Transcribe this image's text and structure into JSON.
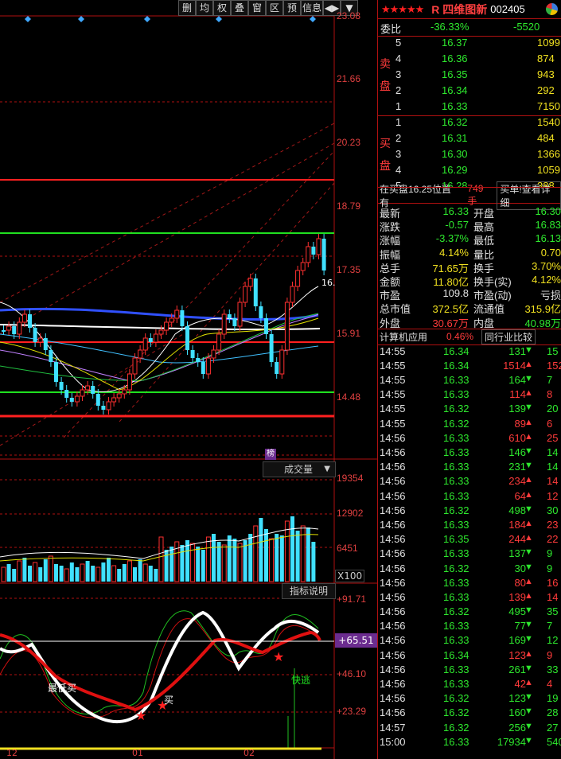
{
  "toolbar": {
    "buttons": [
      "删",
      "均",
      "权",
      "叠",
      "窗",
      "区",
      "预",
      "信息",
      "◀▶",
      "▼"
    ]
  },
  "price_axis": [
    "23.08",
    "21.66",
    "20.23",
    "18.79",
    "17.35",
    "15.91",
    "14.48"
  ],
  "vol_axis": [
    "19354",
    "12902",
    "6451"
  ],
  "ind_axis": {
    "top": "+91.71",
    "highlight": "+65.51",
    "mid": "+46.10",
    "low": "+23.29"
  },
  "chart": {
    "last_price_label": "16.",
    "vol_dropdown": "成交量",
    "ind_dropdown": "指标说明",
    "x100": "X100",
    "bang": "榜",
    "annot_low_buy": "最低买",
    "annot_buy": "买",
    "annot_escape": "快逃",
    "x_labels": [
      "12",
      "01",
      "02"
    ],
    "colors": {
      "up": "#ff3030",
      "down": "#40e0ff",
      "ma_white": "#ffffff",
      "ma_red": "#dd1111"
    }
  },
  "header": {
    "stars": "★★★★★",
    "prefix": "R",
    "name": "四维图新",
    "code": "002405"
  },
  "orderbook": {
    "weibi_label": "委比",
    "weibi_pct": "-36.33%",
    "weibi_diff": "-5520",
    "sell_label": "卖盘",
    "buy_label": "买盘",
    "sell": [
      {
        "n": "5",
        "price": "16.37",
        "vol": "1099"
      },
      {
        "n": "4",
        "price": "16.36",
        "vol": "874"
      },
      {
        "n": "3",
        "price": "16.35",
        "vol": "943"
      },
      {
        "n": "2",
        "price": "16.34",
        "vol": "292"
      },
      {
        "n": "1",
        "price": "16.33",
        "vol": "7150"
      }
    ],
    "buy": [
      {
        "n": "1",
        "price": "16.32",
        "vol": "1540"
      },
      {
        "n": "2",
        "price": "16.31",
        "vol": "484"
      },
      {
        "n": "3",
        "price": "16.30",
        "vol": "1366"
      },
      {
        "n": "4",
        "price": "16.29",
        "vol": "1059"
      },
      {
        "n": "5",
        "price": "16.28",
        "vol": "388"
      }
    ]
  },
  "notice": {
    "text": "在买盘16.25位置有",
    "qty": "749手",
    "link": "买单!查看详细"
  },
  "quote": [
    {
      "l1": "最新",
      "v1": "16.33",
      "c1": "green",
      "l2": "开盘",
      "v2": "16.30",
      "c2": "green"
    },
    {
      "l1": "涨跌",
      "v1": "-0.57",
      "c1": "green",
      "l2": "最高",
      "v2": "16.83",
      "c2": "green"
    },
    {
      "l1": "涨幅",
      "v1": "-3.37%",
      "c1": "green",
      "l2": "最低",
      "v2": "16.13",
      "c2": "green"
    },
    {
      "l1": "振幅",
      "v1": "4.14%",
      "c1": "yellow",
      "l2": "量比",
      "v2": "0.70",
      "c2": "yellow"
    },
    {
      "l1": "总手",
      "v1": "71.65万",
      "c1": "yellow",
      "l2": "换手",
      "v2": "3.70%",
      "c2": "yellow"
    },
    {
      "l1": "金额",
      "v1": "11.80亿",
      "c1": "yellow",
      "l2": "换手(实)",
      "v2": "4.12%",
      "c2": "yellow"
    },
    {
      "l1": "市盈",
      "v1": "109.8",
      "c1": "white",
      "l2": "市盈(动)",
      "v2": "亏损",
      "c2": "white"
    },
    {
      "l1": "总市值",
      "v1": "372.5亿",
      "c1": "yellow",
      "l2": "流通值",
      "v2": "315.9亿",
      "c2": "yellow"
    },
    {
      "l1": "外盘",
      "v1": "30.67万",
      "c1": "red",
      "l2": "内盘",
      "v2": "40.98万",
      "c2": "green"
    }
  ],
  "sector": {
    "name": "计算机应用",
    "pct": "0.46%",
    "compare": "同行业比较"
  },
  "ticks": [
    {
      "t": "14:55",
      "p": "16.34",
      "pc": "green",
      "v": "131",
      "d": "down",
      "x": "15"
    },
    {
      "t": "14:55",
      "p": "16.34",
      "pc": "green",
      "v": "1514",
      "d": "up",
      "x": "152"
    },
    {
      "t": "14:55",
      "p": "16.33",
      "pc": "green",
      "v": "164",
      "d": "down",
      "x": "7"
    },
    {
      "t": "14:55",
      "p": "16.33",
      "pc": "green",
      "v": "114",
      "d": "up",
      "x": "8"
    },
    {
      "t": "14:55",
      "p": "16.32",
      "pc": "green",
      "v": "139",
      "d": "down",
      "x": "20"
    },
    {
      "t": "14:55",
      "p": "16.32",
      "pc": "green",
      "v": "89",
      "d": "up",
      "x": "6"
    },
    {
      "t": "14:56",
      "p": "16.33",
      "pc": "green",
      "v": "610",
      "d": "up",
      "x": "25"
    },
    {
      "t": "14:56",
      "p": "16.33",
      "pc": "green",
      "v": "146",
      "d": "down",
      "x": "14"
    },
    {
      "t": "14:56",
      "p": "16.33",
      "pc": "green",
      "v": "231",
      "d": "down",
      "x": "14"
    },
    {
      "t": "14:56",
      "p": "16.33",
      "pc": "green",
      "v": "234",
      "d": "up",
      "x": "14"
    },
    {
      "t": "14:56",
      "p": "16.33",
      "pc": "green",
      "v": "64",
      "d": "up",
      "x": "12"
    },
    {
      "t": "14:56",
      "p": "16.32",
      "pc": "green",
      "v": "498",
      "d": "down",
      "x": "30"
    },
    {
      "t": "14:56",
      "p": "16.33",
      "pc": "green",
      "v": "184",
      "d": "up",
      "x": "23"
    },
    {
      "t": "14:56",
      "p": "16.35",
      "pc": "green",
      "v": "244",
      "d": "up",
      "x": "22"
    },
    {
      "t": "14:56",
      "p": "16.33",
      "pc": "green",
      "v": "137",
      "d": "down",
      "x": "9"
    },
    {
      "t": "14:56",
      "p": "16.32",
      "pc": "green",
      "v": "30",
      "d": "down",
      "x": "9"
    },
    {
      "t": "14:56",
      "p": "16.33",
      "pc": "green",
      "v": "80",
      "d": "up",
      "x": "16"
    },
    {
      "t": "14:56",
      "p": "16.33",
      "pc": "green",
      "v": "139",
      "d": "up",
      "x": "14"
    },
    {
      "t": "14:56",
      "p": "16.32",
      "pc": "green",
      "v": "495",
      "d": "down",
      "x": "35"
    },
    {
      "t": "14:56",
      "p": "16.33",
      "pc": "green",
      "v": "77",
      "d": "down",
      "x": "7"
    },
    {
      "t": "14:56",
      "p": "16.33",
      "pc": "green",
      "v": "169",
      "d": "down",
      "x": "12"
    },
    {
      "t": "14:56",
      "p": "16.34",
      "pc": "green",
      "v": "123",
      "d": "up",
      "x": "9"
    },
    {
      "t": "14:56",
      "p": "16.33",
      "pc": "green",
      "v": "261",
      "d": "down",
      "x": "33"
    },
    {
      "t": "14:56",
      "p": "16.33",
      "pc": "green",
      "v": "42",
      "d": "up",
      "x": "4"
    },
    {
      "t": "14:56",
      "p": "16.32",
      "pc": "green",
      "v": "123",
      "d": "down",
      "x": "19"
    },
    {
      "t": "14:56",
      "p": "16.32",
      "pc": "green",
      "v": "160",
      "d": "down",
      "x": "28"
    },
    {
      "t": "14:57",
      "p": "16.32",
      "pc": "green",
      "v": "256",
      "d": "down",
      "x": "27"
    },
    {
      "t": "15:00",
      "p": "16.33",
      "pc": "green",
      "v": "17934",
      "d": "down",
      "x": "540"
    }
  ]
}
